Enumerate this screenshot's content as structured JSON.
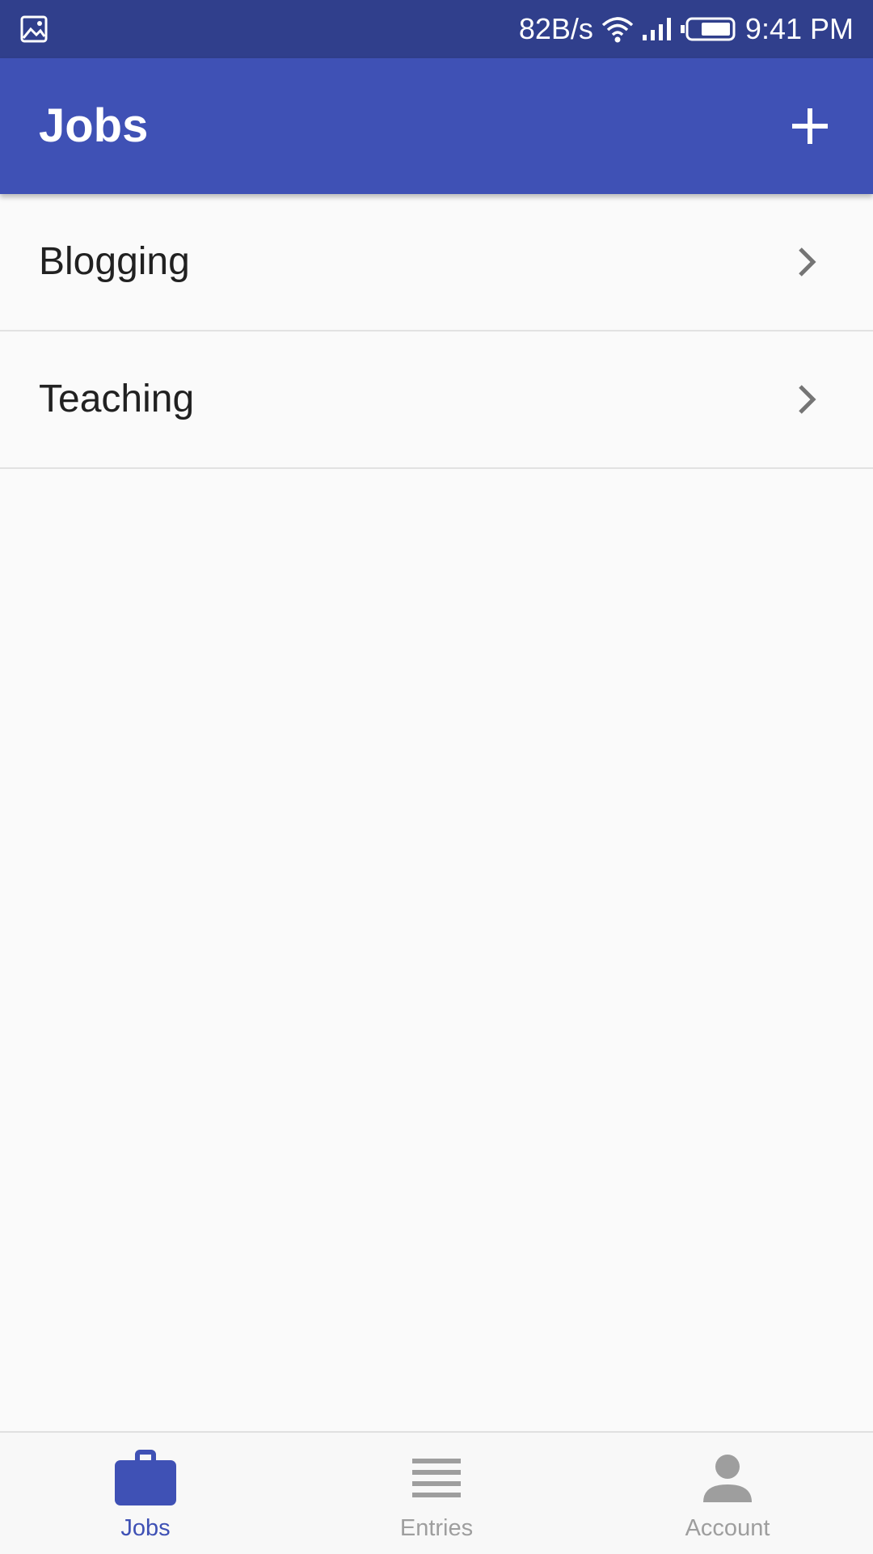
{
  "status_bar": {
    "speed": "82B/s",
    "time": "9:41 PM",
    "icons": [
      "gallery-icon",
      "wifi-icon",
      "signal-icon",
      "battery-icon"
    ]
  },
  "app_bar": {
    "title": "Jobs",
    "add_icon": "plus-icon"
  },
  "jobs": [
    {
      "label": "Blogging",
      "icon": "chevron-right-icon"
    },
    {
      "label": "Teaching",
      "icon": "chevron-right-icon"
    }
  ],
  "bottom_nav": {
    "items": [
      {
        "label": "Jobs",
        "icon": "briefcase-icon",
        "active": true
      },
      {
        "label": "Entries",
        "icon": "list-icon",
        "active": false
      },
      {
        "label": "Account",
        "icon": "person-icon",
        "active": false
      }
    ]
  },
  "colors": {
    "primary": "#3f51b5",
    "status_bar": "#303f8c",
    "background": "#fafafa",
    "inactive": "#9e9e9e"
  }
}
